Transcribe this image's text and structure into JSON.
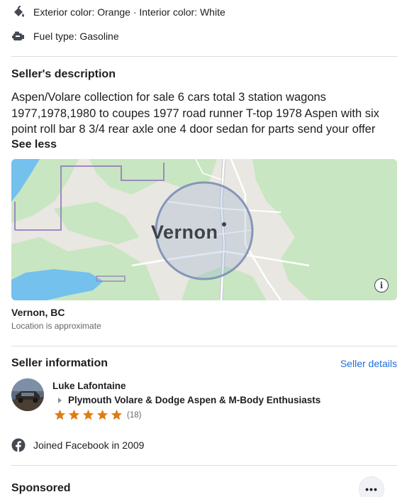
{
  "details": {
    "color_text": "Exterior color: Orange · Interior color: White",
    "color_icon": "paint-bucket-icon",
    "fuel_text": "Fuel type: Gasoline",
    "fuel_icon": "fuel-pump-icon"
  },
  "description": {
    "title": "Seller's description",
    "text": "Aspen/Volare collection for sale 6 cars total 3 station wagons 1977,1978,1980 to coupes 1977 road runner T-top 1978 Aspen with six point roll bar 8 3/4 rear axle one 4 door sedan for parts  send your offer",
    "see_less": "See less"
  },
  "map": {
    "label": "Vernon",
    "info_icon": "info-icon",
    "info_glyph": "i",
    "location_name": "Vernon, BC",
    "location_note": "Location is approximate",
    "colors": {
      "land": "#e9e7e1",
      "green": "#c8e6c1",
      "water": "#74c1ee",
      "radius": "#8496b8"
    }
  },
  "seller": {
    "title": "Seller information",
    "details_link": "Seller details",
    "name": "Luke Lafontaine",
    "group": "Plymouth Volare & Dodge Aspen & M-Body Enthusiasts",
    "rating_stars": 5,
    "rating_count": "(18)",
    "joined": "Joined Facebook in 2009",
    "star_color": "#e07c12"
  },
  "sponsored": {
    "title": "Sponsored",
    "more_label": "•••"
  }
}
